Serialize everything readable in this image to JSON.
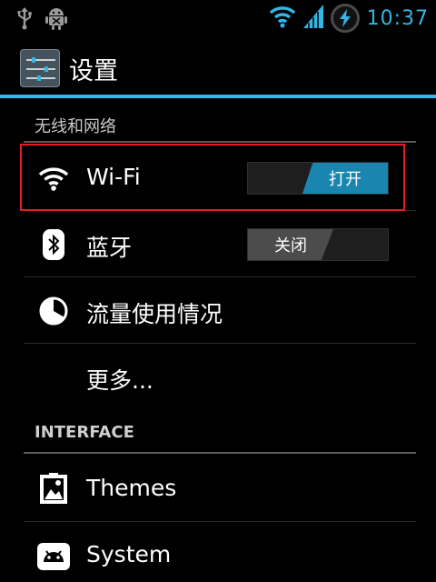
{
  "status_bar": {
    "time": "10:37",
    "left_icons": [
      "usb-icon",
      "android-debug-icon"
    ],
    "right_icons": [
      "wifi-signal-icon",
      "cell-signal-icon",
      "battery-charging-icon"
    ],
    "accent_color": "#33b5e5"
  },
  "action_bar": {
    "title": "设置",
    "icon": "settings-sliders-icon"
  },
  "sections": [
    {
      "header": "无线和网络",
      "items": [
        {
          "label": "Wi-Fi",
          "icon": "wifi-icon",
          "toggle": "打开",
          "toggle_state": "on"
        },
        {
          "label": "蓝牙",
          "icon": "bluetooth-icon",
          "toggle": "关闭",
          "toggle_state": "off"
        },
        {
          "label": "流量使用情况",
          "icon": "data-usage-icon"
        },
        {
          "label": "更多..."
        }
      ]
    },
    {
      "header": "INTERFACE",
      "items": [
        {
          "label": "Themes",
          "icon": "themes-icon"
        },
        {
          "label": "System",
          "icon": "system-android-icon"
        }
      ]
    }
  ]
}
